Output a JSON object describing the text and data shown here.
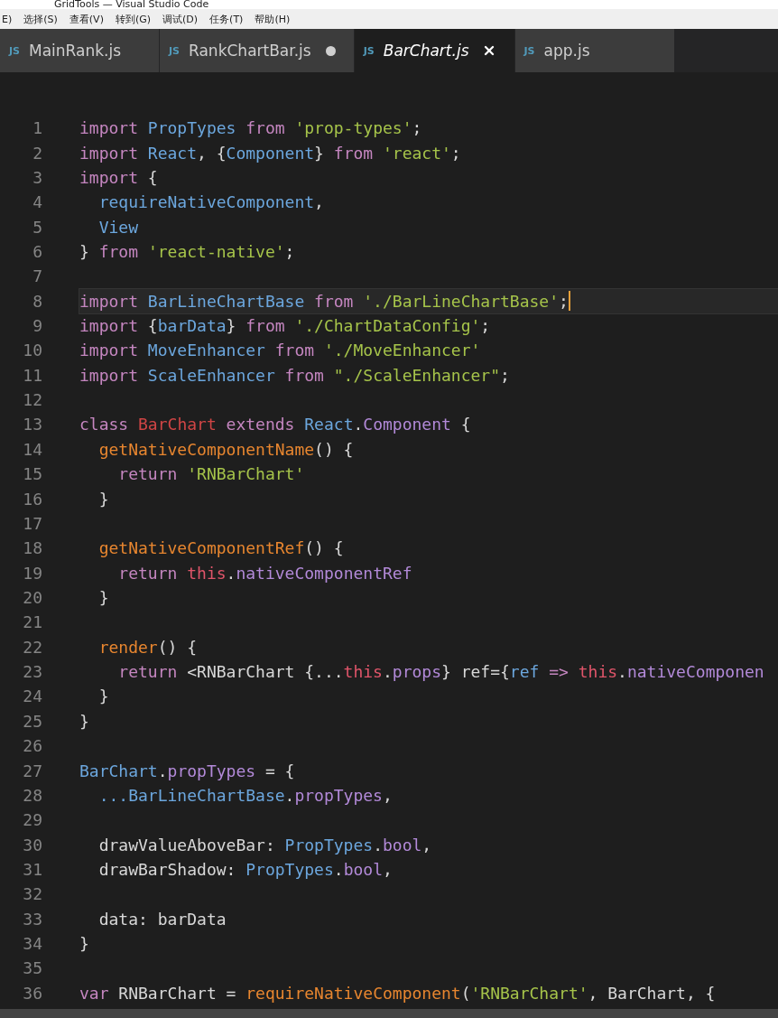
{
  "window": {
    "title": "GridTools — Visual Studio Code"
  },
  "menu": [
    "E)",
    "选择(S)",
    "查看(V)",
    "转到(G)",
    "调试(D)",
    "任务(T)",
    "帮助(H)"
  ],
  "tabs": [
    {
      "icon": "JS",
      "label": "MainRank.js",
      "selected": false,
      "modified": false
    },
    {
      "icon": "JS",
      "label": "RankChartBar.js",
      "selected": false,
      "modified": true
    },
    {
      "icon": "JS",
      "label": "BarChart.js",
      "selected": true,
      "modified": false
    },
    {
      "icon": "JS",
      "label": "app.js",
      "selected": false,
      "modified": false
    }
  ],
  "lines": [
    {
      "number": "1",
      "current": false,
      "tokens": [
        {
          "kind": "kw",
          "t": "import "
        },
        {
          "kind": "id",
          "t": "PropTypes"
        },
        {
          "kind": "kw",
          "t": " from "
        },
        {
          "kind": "str",
          "t": "'prop-types'"
        },
        {
          "kind": "tx",
          "t": ";"
        }
      ]
    },
    {
      "number": "2",
      "current": false,
      "tokens": [
        {
          "kind": "kw",
          "t": "import "
        },
        {
          "kind": "id",
          "t": "React"
        },
        {
          "kind": "tx",
          "t": ", {"
        },
        {
          "kind": "id",
          "t": "Component"
        },
        {
          "kind": "tx",
          "t": "} "
        },
        {
          "kind": "kw",
          "t": "from "
        },
        {
          "kind": "str",
          "t": "'react'"
        },
        {
          "kind": "tx",
          "t": ";"
        }
      ]
    },
    {
      "number": "3",
      "current": false,
      "tokens": [
        {
          "kind": "kw",
          "t": "import "
        },
        {
          "kind": "tx",
          "t": "{"
        }
      ]
    },
    {
      "number": "4",
      "current": false,
      "tokens": [
        {
          "kind": "id",
          "t": "  requireNativeComponent"
        },
        {
          "kind": "tx",
          "t": ","
        }
      ]
    },
    {
      "number": "5",
      "current": false,
      "tokens": [
        {
          "kind": "id",
          "t": "  View"
        }
      ]
    },
    {
      "number": "6",
      "current": false,
      "tokens": [
        {
          "kind": "tx",
          "t": "} "
        },
        {
          "kind": "kw",
          "t": "from "
        },
        {
          "kind": "str",
          "t": "'react-native'"
        },
        {
          "kind": "tx",
          "t": ";"
        }
      ]
    },
    {
      "number": "7",
      "current": false
    },
    {
      "number": "8",
      "current": true,
      "tokens": [
        {
          "kind": "kw",
          "t": "import "
        },
        {
          "kind": "id",
          "t": "BarLineChartBase"
        },
        {
          "kind": "kw",
          "t": " from "
        },
        {
          "kind": "str",
          "t": "'./BarLineChartBase'"
        },
        {
          "kind": "tx",
          "t": ";"
        }
      ]
    },
    {
      "number": "9",
      "current": false,
      "tokens": [
        {
          "kind": "kw",
          "t": "import "
        },
        {
          "kind": "tx",
          "t": "{"
        },
        {
          "kind": "id",
          "t": "barData"
        },
        {
          "kind": "tx",
          "t": "} "
        },
        {
          "kind": "kw",
          "t": "from "
        },
        {
          "kind": "str",
          "t": "'./ChartDataConfig'"
        },
        {
          "kind": "tx",
          "t": ";"
        }
      ]
    },
    {
      "number": "10",
      "current": false,
      "tokens": [
        {
          "kind": "kw",
          "t": "import "
        },
        {
          "kind": "id",
          "t": "MoveEnhancer"
        },
        {
          "kind": "kw",
          "t": " from "
        },
        {
          "kind": "str",
          "t": "'./MoveEnhancer'"
        }
      ]
    },
    {
      "number": "11",
      "current": false,
      "tokens": [
        {
          "kind": "kw",
          "t": "import "
        },
        {
          "kind": "id",
          "t": "ScaleEnhancer"
        },
        {
          "kind": "kw",
          "t": " from "
        },
        {
          "kind": "str",
          "t": "\"./ScaleEnhancer\""
        },
        {
          "kind": "tx",
          "t": ";"
        }
      ]
    },
    {
      "number": "12",
      "current": false
    },
    {
      "number": "13",
      "current": false,
      "tokens": [
        {
          "kind": "kw",
          "t": "class "
        },
        {
          "kind": "cls",
          "t": "BarChart"
        },
        {
          "kind": "kw",
          "t": " extends "
        },
        {
          "kind": "id",
          "t": "React"
        },
        {
          "kind": "tx",
          "t": "."
        },
        {
          "kind": "prop",
          "t": "Component"
        },
        {
          "kind": "tx",
          "t": " {"
        }
      ]
    },
    {
      "number": "14",
      "current": false,
      "tokens": [
        {
          "kind": "fn",
          "t": "  getNativeComponentName"
        },
        {
          "kind": "tx",
          "t": "() {"
        }
      ]
    },
    {
      "number": "15",
      "current": false,
      "tokens": [
        {
          "kind": "kw",
          "t": "    return "
        },
        {
          "kind": "str",
          "t": "'RNBarChart'"
        }
      ]
    },
    {
      "number": "16",
      "current": false,
      "tokens": [
        {
          "kind": "tx",
          "t": "  }"
        }
      ]
    },
    {
      "number": "17",
      "current": false
    },
    {
      "number": "18",
      "current": false,
      "tokens": [
        {
          "kind": "fn",
          "t": "  getNativeComponentRef"
        },
        {
          "kind": "tx",
          "t": "() {"
        }
      ]
    },
    {
      "number": "19",
      "current": false,
      "tokens": [
        {
          "kind": "kw",
          "t": "    return "
        },
        {
          "kind": "this",
          "t": "this"
        },
        {
          "kind": "tx",
          "t": "."
        },
        {
          "kind": "prop",
          "t": "nativeComponentRef"
        }
      ]
    },
    {
      "number": "20",
      "current": false,
      "tokens": [
        {
          "kind": "tx",
          "t": "  }"
        }
      ]
    },
    {
      "number": "21",
      "current": false
    },
    {
      "number": "22",
      "current": false,
      "tokens": [
        {
          "kind": "fn",
          "t": "  render"
        },
        {
          "kind": "tx",
          "t": "() {"
        }
      ]
    },
    {
      "number": "23",
      "current": false,
      "tokens": [
        {
          "kind": "kw",
          "t": "    return "
        },
        {
          "kind": "tx",
          "t": "<RNBarChart {..."
        },
        {
          "kind": "this",
          "t": "this"
        },
        {
          "kind": "tx",
          "t": "."
        },
        {
          "kind": "prop",
          "t": "props"
        },
        {
          "kind": "tx",
          "t": "} ref={"
        },
        {
          "kind": "id",
          "t": "ref"
        },
        {
          "kind": "kw",
          "t": " => "
        },
        {
          "kind": "this",
          "t": "this"
        },
        {
          "kind": "tx",
          "t": "."
        },
        {
          "kind": "prop",
          "t": "nativeComponen"
        }
      ]
    },
    {
      "number": "24",
      "current": false,
      "tokens": [
        {
          "kind": "tx",
          "t": "  }"
        }
      ]
    },
    {
      "number": "25",
      "current": false,
      "tokens": [
        {
          "kind": "tx",
          "t": "}"
        }
      ]
    },
    {
      "number": "26",
      "current": false
    },
    {
      "number": "27",
      "current": false,
      "tokens": [
        {
          "kind": "id",
          "t": "BarChart"
        },
        {
          "kind": "tx",
          "t": "."
        },
        {
          "kind": "prop",
          "t": "propTypes"
        },
        {
          "kind": "tx",
          "t": " = {"
        }
      ]
    },
    {
      "number": "28",
      "current": false,
      "tokens": [
        {
          "kind": "id",
          "t": "  ...BarLineChartBase"
        },
        {
          "kind": "tx",
          "t": "."
        },
        {
          "kind": "prop",
          "t": "propTypes"
        },
        {
          "kind": "tx",
          "t": ","
        }
      ]
    },
    {
      "number": "29",
      "current": false
    },
    {
      "number": "30",
      "current": false,
      "tokens": [
        {
          "kind": "tx",
          "t": "  drawValueAboveBar: "
        },
        {
          "kind": "id",
          "t": "PropTypes"
        },
        {
          "kind": "tx",
          "t": "."
        },
        {
          "kind": "prop",
          "t": "bool"
        },
        {
          "kind": "tx",
          "t": ","
        }
      ]
    },
    {
      "number": "31",
      "current": false,
      "tokens": [
        {
          "kind": "tx",
          "t": "  drawBarShadow: "
        },
        {
          "kind": "id",
          "t": "PropTypes"
        },
        {
          "kind": "tx",
          "t": "."
        },
        {
          "kind": "prop",
          "t": "bool"
        },
        {
          "kind": "tx",
          "t": ","
        }
      ]
    },
    {
      "number": "32",
      "current": false
    },
    {
      "number": "33",
      "current": false,
      "tokens": [
        {
          "kind": "tx",
          "t": "  data: "
        },
        {
          "kind": "tx",
          "t": "barData"
        }
      ]
    },
    {
      "number": "34",
      "current": false,
      "tokens": [
        {
          "kind": "tx",
          "t": "}"
        }
      ]
    },
    {
      "number": "35",
      "current": false
    },
    {
      "number": "36",
      "current": false,
      "tokens": [
        {
          "kind": "kw",
          "t": "var "
        },
        {
          "kind": "tx",
          "t": "RNBarChart = "
        },
        {
          "kind": "fn",
          "t": "requireNativeComponent"
        },
        {
          "kind": "tx",
          "t": "("
        },
        {
          "kind": "str",
          "t": "'RNBarChart'"
        },
        {
          "kind": "tx",
          "t": ", BarChart, {"
        }
      ]
    }
  ]
}
